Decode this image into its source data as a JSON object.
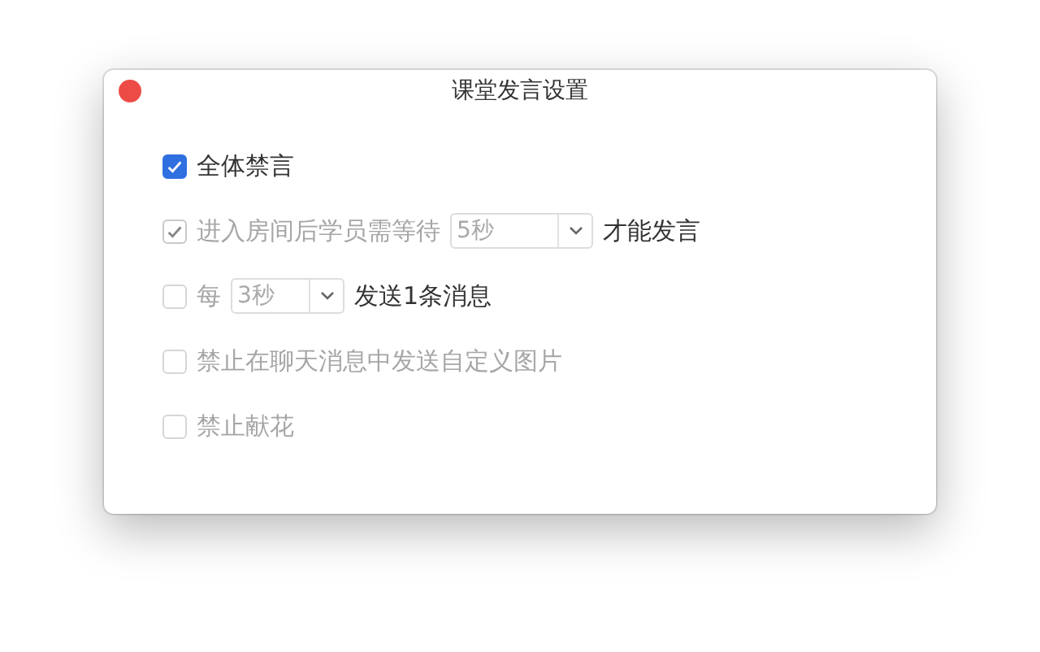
{
  "window": {
    "title": "课堂发言设置"
  },
  "rows": [
    {
      "checked": true,
      "disabled": false,
      "parts": [
        {
          "kind": "text",
          "text": "全体禁言",
          "disabled": false
        }
      ]
    },
    {
      "checked": true,
      "disabled": true,
      "parts": [
        {
          "kind": "text",
          "text": "进入房间后学员需等待",
          "disabled": true
        },
        {
          "kind": "select",
          "value": "5秒",
          "disabled": true
        },
        {
          "kind": "text",
          "text": "才能发言",
          "disabled": false
        }
      ]
    },
    {
      "checked": false,
      "disabled": true,
      "parts": [
        {
          "kind": "text",
          "text": "每",
          "disabled": true
        },
        {
          "kind": "select",
          "value": "3秒",
          "disabled": true
        },
        {
          "kind": "text",
          "text": "发送1条消息",
          "disabled": false
        }
      ]
    },
    {
      "checked": false,
      "disabled": true,
      "parts": [
        {
          "kind": "text",
          "text": "禁止在聊天消息中发送自定义图片",
          "disabled": true
        }
      ]
    },
    {
      "checked": false,
      "disabled": true,
      "parts": [
        {
          "kind": "text",
          "text": "禁止献花",
          "disabled": true
        }
      ]
    }
  ]
}
